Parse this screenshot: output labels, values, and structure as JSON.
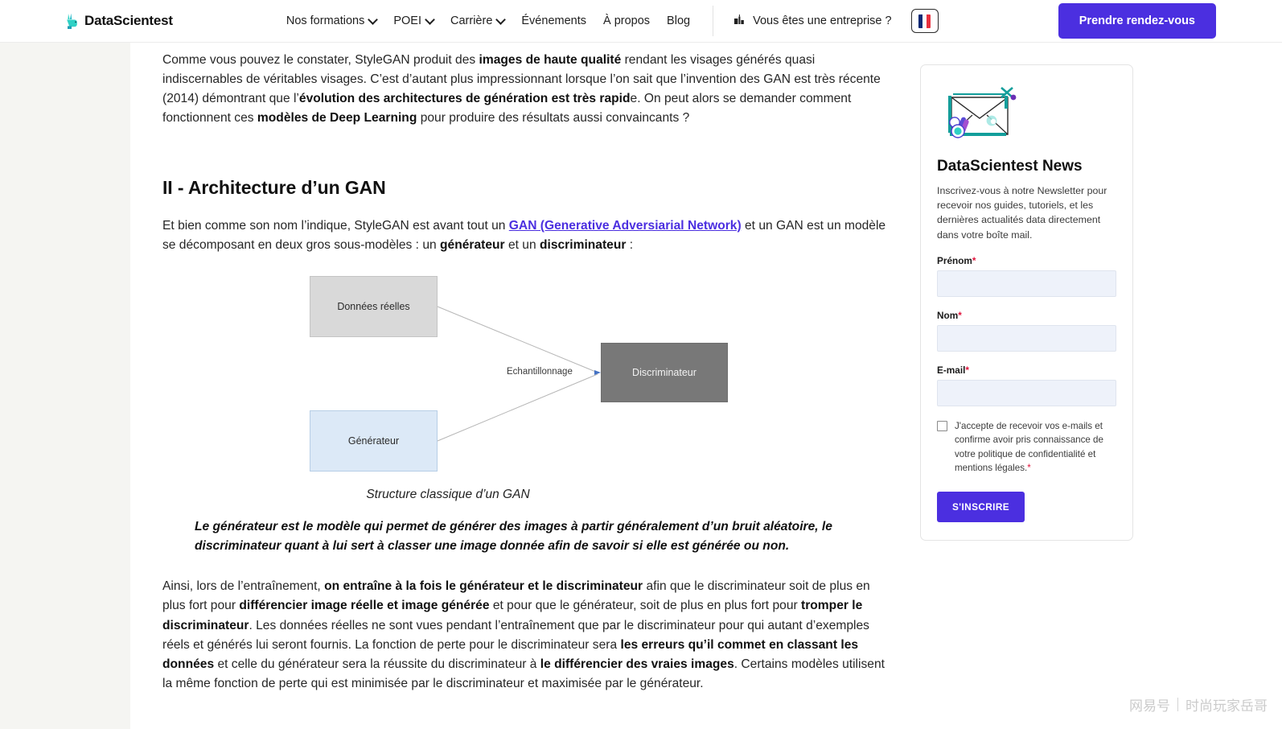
{
  "header": {
    "logo_text": "DataScientest",
    "logo_icon": "rabbit-logo-icon",
    "nav": [
      {
        "label": "Nos formations",
        "has_chevron": true
      },
      {
        "label": "POEI",
        "has_chevron": true
      },
      {
        "label": "Carrière",
        "has_chevron": true
      },
      {
        "label": "Événements",
        "has_chevron": false
      },
      {
        "label": "À propos",
        "has_chevron": false
      },
      {
        "label": "Blog",
        "has_chevron": false
      }
    ],
    "enterprise_label": "Vous êtes une entreprise ?",
    "enterprise_icon": "building-icon",
    "language": "FR",
    "flag_icon": "french-flag-icon",
    "cta_label": "Prendre rendez-vous",
    "accent_color": "#4b2fe0"
  },
  "article": {
    "p1_part1": "Comme vous pouvez le constater, StyleGAN produit des ",
    "p1_bold1": "images de haute qualité",
    "p1_part2": " rendant les visages générés quasi indiscernables de véritables visages. C’est d’autant plus impressionnant lorsque l’on sait que l’invention des GAN est très récente (2014) démontrant que l’",
    "p1_bold2": "évolution des architectures de génération est très rapid",
    "p1_part3": "e. On peut alors se demander comment fonctionnent ces ",
    "p1_bold3": "modèles de Deep Learning",
    "p1_part4": " pour produire des résultats aussi convaincants ?",
    "heading": "II - Architecture d’un GAN",
    "p2_part1": "Et bien comme son nom l’indique, StyleGAN est avant tout un ",
    "p2_link": "GAN (Generative Adversiarial Network)",
    "p2_part2": " et un GAN est un modèle se décomposant en deux gros sous-modèles : un ",
    "p2_bold1": "générateur",
    "p2_part3": " et un ",
    "p2_bold2": "discriminateur",
    "p2_part4": " :",
    "figure_caption": "Structure classique d’un GAN",
    "quote": "Le générateur est le modèle qui permet de générer des images à partir généralement d’un bruit aléatoire, le discriminateur quant à lui sert à classer une image donnée afin de savoir si elle est générée ou non.",
    "p3_part1": "Ainsi, lors de l’entraînement, ",
    "p3_bold1": "on entraîne à la fois le générateur et le discriminateur",
    "p3_part2": " afin que le discriminateur soit de plus en plus fort pour ",
    "p3_bold2": "différencier image réelle et image générée",
    "p3_part3": " et pour que le générateur, soit de plus en plus fort pour ",
    "p3_bold3": "tromper le discriminateur",
    "p3_part4": ". Les données réelles ne sont vues pendant l’entraînement que par le discriminateur pour qui autant d’exemples réels et générés lui seront fournis. La fonction de perte pour le discriminateur sera ",
    "p3_bold4": "les erreurs qu’il commet en classant les données",
    "p3_part5": " et celle du générateur sera la réussite du discriminateur à ",
    "p3_bold5": "le différencier des vraies images",
    "p3_part6": ". Certains modèles utilisent la même fonction de perte qui est minimisée par le discriminateur et maximisée par le générateur."
  },
  "diagram": {
    "box_real": "Données réelles",
    "box_generator": "Générateur",
    "box_discriminator": "Discriminateur",
    "edge_label": "Echantillonnage",
    "color_real": "#d9d9d9",
    "color_generator": "#dce9f7",
    "color_discriminator": "#787878"
  },
  "sidebar": {
    "illustration_icon": "newsletter-envelope-icon",
    "title": "DataScientest News",
    "description": "Inscrivez-vous à notre Newsletter pour recevoir nos guides, tutoriels, et les dernières actualités data directement dans votre boîte mail.",
    "fields": [
      {
        "label": "Prénom",
        "required": "*",
        "value": "",
        "placeholder": ""
      },
      {
        "label": "Nom",
        "required": "*",
        "value": "",
        "placeholder": ""
      },
      {
        "label": "E-mail",
        "required": "*",
        "value": "",
        "placeholder": ""
      }
    ],
    "consent_text": "J'accepte de recevoir vos e-mails et confirme avoir pris connaissance de votre politique de confidentialité et mentions légales.",
    "consent_required": "*",
    "consent_checked": false,
    "submit_label": "S'INSCRIRE"
  },
  "watermark": {
    "source": "网易号",
    "author": "时尚玩家岳哥"
  }
}
